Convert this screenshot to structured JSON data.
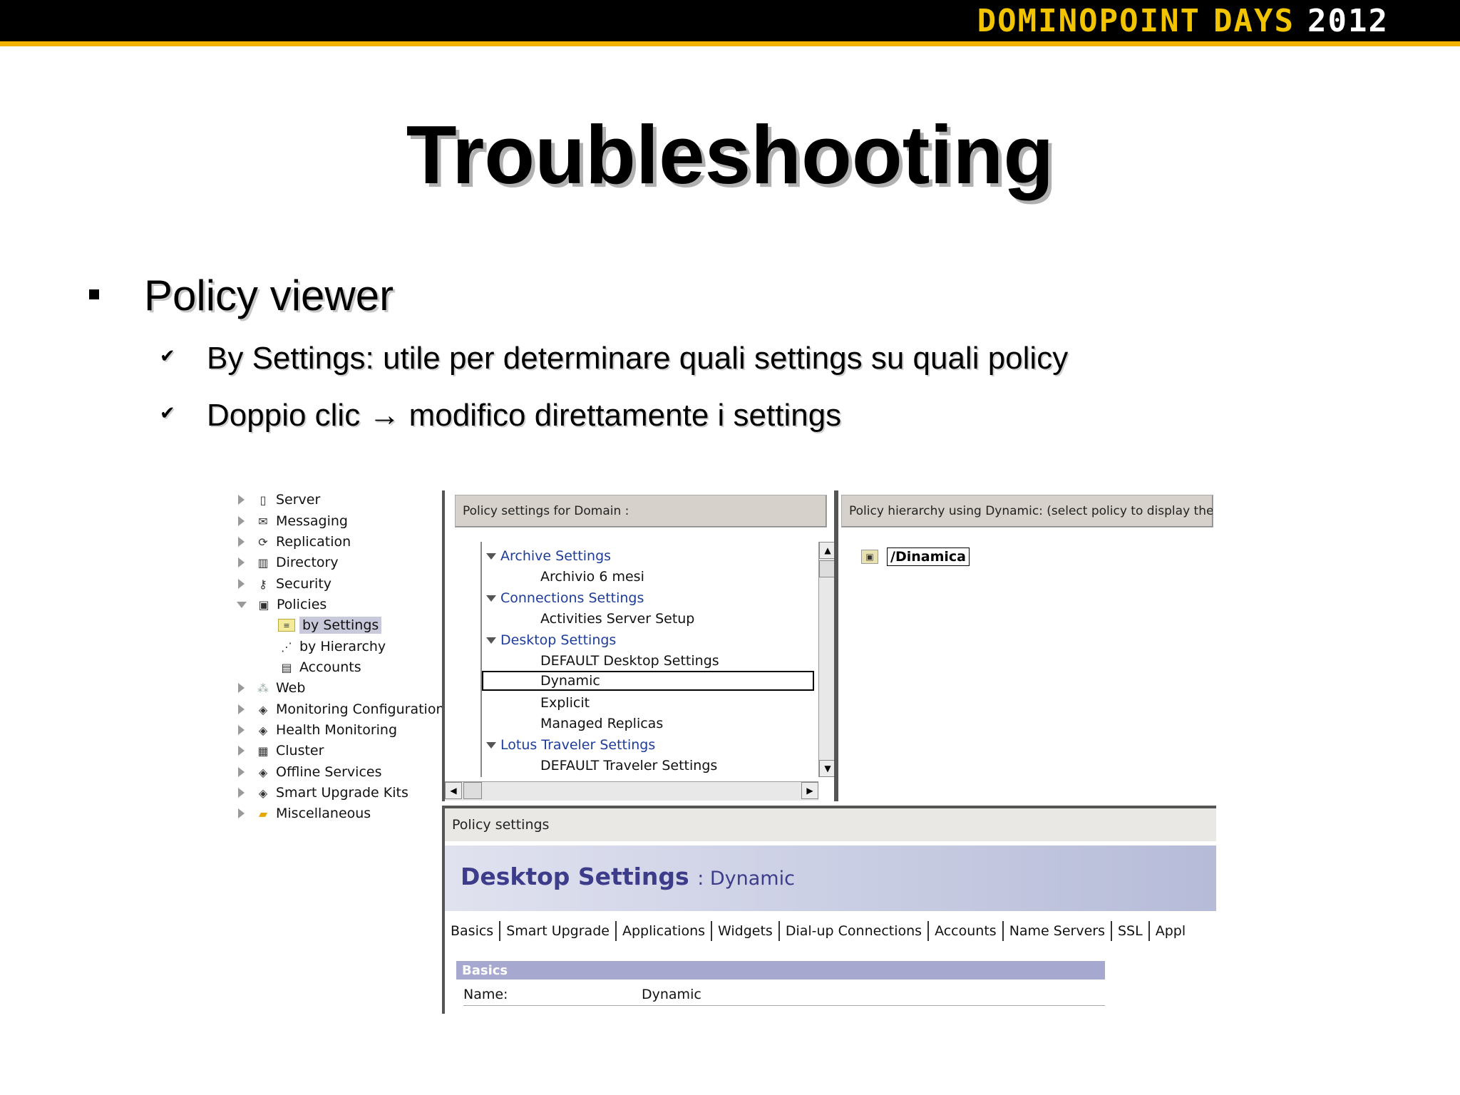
{
  "banner": {
    "logo_part1": "DOMINOPOINT",
    "logo_part2": "DAYS",
    "logo_year": "2012"
  },
  "slide": {
    "title": "Troubleshooting",
    "bullet": "Policy viewer",
    "sub_bullets": [
      "By Settings: utile per determinare quali settings su quali policy",
      "Doppio clic → modifico direttamente i settings"
    ]
  },
  "tree": {
    "items": [
      {
        "label": "Server",
        "icon": "server-icon"
      },
      {
        "label": "Messaging",
        "icon": "messaging-icon"
      },
      {
        "label": "Replication",
        "icon": "replication-icon"
      },
      {
        "label": "Directory",
        "icon": "directory-icon"
      },
      {
        "label": "Security",
        "icon": "key-icon"
      },
      {
        "label": "Policies",
        "icon": "policies-icon"
      },
      {
        "label": "by Settings",
        "icon": "settings-doc-icon"
      },
      {
        "label": "by Hierarchy",
        "icon": "hierarchy-icon"
      },
      {
        "label": "Accounts",
        "icon": "accounts-icon"
      },
      {
        "label": "Web",
        "icon": "web-icon"
      },
      {
        "label": "Monitoring Configuration",
        "icon": "monitoring-icon"
      },
      {
        "label": "Health Monitoring",
        "icon": "health-icon"
      },
      {
        "label": "Cluster",
        "icon": "cluster-icon"
      },
      {
        "label": "Offline Services",
        "icon": "offline-icon"
      },
      {
        "label": "Smart Upgrade Kits",
        "icon": "upgrade-icon"
      },
      {
        "label": "Miscellaneous",
        "icon": "folder-icon"
      }
    ],
    "selected": "by Settings"
  },
  "left_pane": {
    "header": "Policy settings for Domain :",
    "groups": [
      {
        "label": "Archive Settings",
        "items": [
          "Archivio 6 mesi"
        ]
      },
      {
        "label": "Connections Settings",
        "items": [
          "Activities Server Setup"
        ]
      },
      {
        "label": "Desktop Settings",
        "items": [
          "DEFAULT Desktop Settings",
          "Dynamic",
          "Explicit",
          "Managed Replicas"
        ]
      },
      {
        "label": "Lotus Traveler Settings",
        "items": [
          "DEFAULT Traveler Settings"
        ]
      }
    ],
    "focused_item": "Dynamic"
  },
  "right_pane": {
    "header": "Policy hierarchy using Dynamic:  (select policy to display the ef",
    "policy": "/Dinamica"
  },
  "bottom_pane": {
    "header": "Policy settings",
    "doc_title": "Desktop Settings",
    "doc_subtitle": ": Dynamic",
    "tabs": [
      "Basics",
      "Smart Upgrade",
      "Applications",
      "Widgets",
      "Dial-up Connections",
      "Accounts",
      "Name Servers",
      "SSL",
      "Appl"
    ],
    "section": "Basics",
    "fields": [
      {
        "key": "Name:",
        "value": "Dynamic"
      }
    ]
  }
}
